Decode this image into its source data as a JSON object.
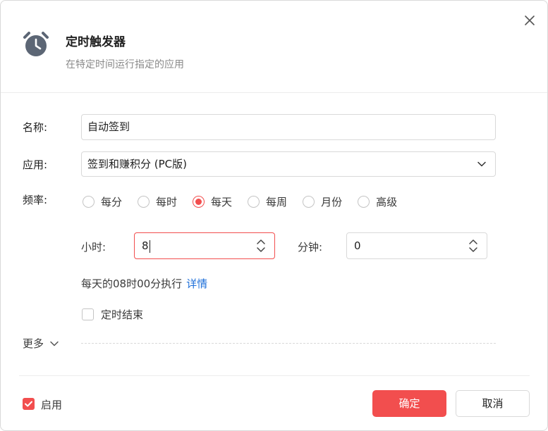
{
  "header": {
    "title": "定时触发器",
    "subtitle": "在特定时间运行指定的应用",
    "icon": "alarm-clock-icon"
  },
  "form": {
    "name": {
      "label": "名称:",
      "value": "自动签到"
    },
    "app": {
      "label": "应用:",
      "value": "签到和赚积分 (PC版)"
    },
    "frequency": {
      "label": "频率:",
      "options": [
        "每分",
        "每时",
        "每天",
        "每周",
        "月份",
        "高级"
      ],
      "selected": "每天"
    },
    "hour": {
      "label": "小时:",
      "value": "8"
    },
    "minute": {
      "label": "分钟:",
      "value": "0"
    },
    "schedule": {
      "text": "每天的08时00分执行",
      "detail_link": "详情"
    },
    "end_timer": {
      "label": "定时结束",
      "checked": false
    },
    "more": {
      "label": "更多"
    }
  },
  "footer": {
    "enable": {
      "label": "启用",
      "checked": true
    },
    "confirm_label": "确定",
    "cancel_label": "取消"
  },
  "colors": {
    "accent": "#f24e4e",
    "link": "#1e6fd9",
    "icon": "#5c6675"
  }
}
